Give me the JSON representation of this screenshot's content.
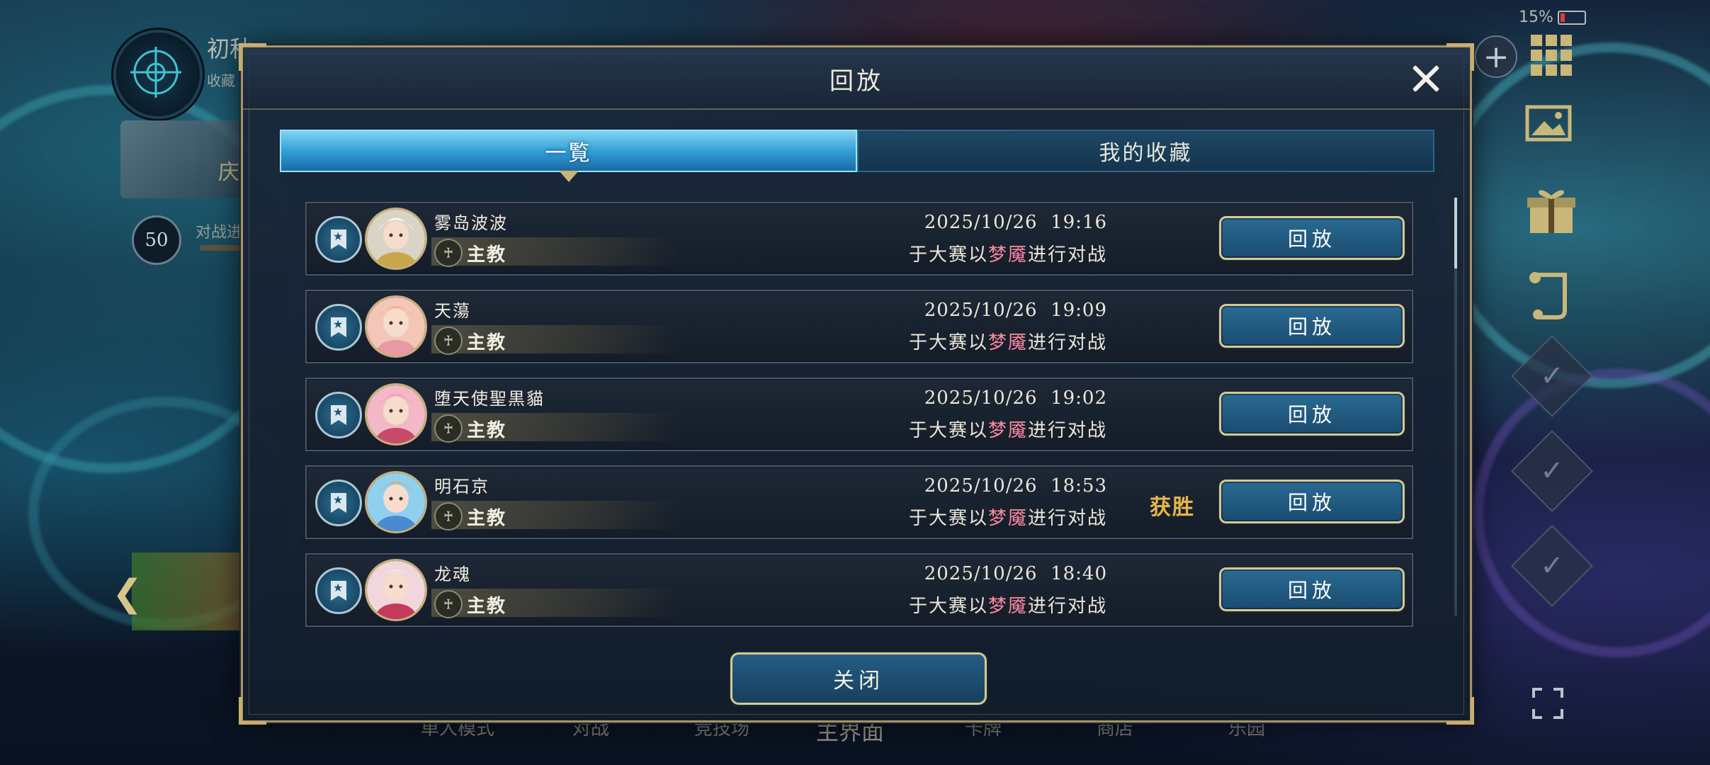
{
  "hud": {
    "player_name": "初秋",
    "player_sub": "收藏",
    "card_text": "庆",
    "level": "50",
    "level_text": "对战进行任",
    "battery": "15%"
  },
  "bottom_nav": [
    "单人模式",
    "对战",
    "竞技场",
    "主界面",
    "卡牌",
    "商店",
    "乐园"
  ],
  "dialog": {
    "title": "回放",
    "tabs": [
      {
        "label": "一覧",
        "active": true
      },
      {
        "label": "我的收藏",
        "active": false
      }
    ],
    "rows": [
      {
        "name": "雾岛波波",
        "class": "主教",
        "datetime": "2025/10/26  19:16",
        "desc_pre": "于大赛以",
        "desc_hl": "梦魇",
        "desc_post": "进行对战",
        "result": "",
        "replay": "回放"
      },
      {
        "name": "天蕩",
        "class": "主教",
        "datetime": "2025/10/26  19:09",
        "desc_pre": "于大赛以",
        "desc_hl": "梦魇",
        "desc_post": "进行对战",
        "result": "",
        "replay": "回放"
      },
      {
        "name": "堕天使聖黒貓",
        "class": "主教",
        "datetime": "2025/10/26  19:02",
        "desc_pre": "于大赛以",
        "desc_hl": "梦魇",
        "desc_post": "进行对战",
        "result": "",
        "replay": "回放"
      },
      {
        "name": "明石京",
        "class": "主教",
        "datetime": "2025/10/26  18:53",
        "desc_pre": "于大赛以",
        "desc_hl": "梦魇",
        "desc_post": "进行对战",
        "result": "获胜",
        "replay": "回放"
      },
      {
        "name": "龙魂",
        "class": "主教",
        "datetime": "2025/10/26  18:40",
        "desc_pre": "于大赛以",
        "desc_hl": "梦魇",
        "desc_post": "进行对战",
        "result": "",
        "replay": "回放"
      }
    ],
    "close_label": "关闭"
  },
  "colors": {
    "accent_gold": "#d8c892",
    "tab_active": "#2e9bd4",
    "highlight_pink": "#ff8aa2",
    "win_gold": "#e7b74a"
  }
}
